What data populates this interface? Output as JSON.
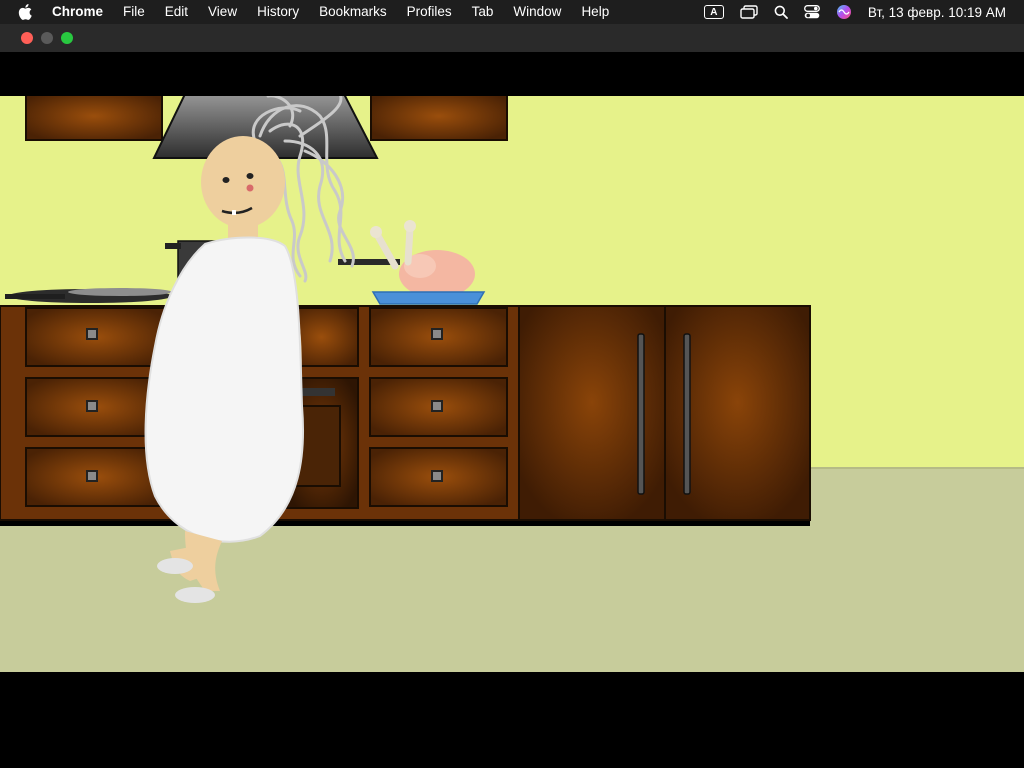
{
  "menubar": {
    "app_name": "Chrome",
    "items": [
      {
        "label": "File"
      },
      {
        "label": "Edit"
      },
      {
        "label": "View"
      },
      {
        "label": "History"
      },
      {
        "label": "Bookmarks"
      },
      {
        "label": "Profiles"
      },
      {
        "label": "Tab"
      },
      {
        "label": "Window"
      },
      {
        "label": "Help"
      }
    ],
    "status": {
      "input_source": "A",
      "clock": "Вт, 13 февр.  10:19 AM"
    }
  },
  "colors": {
    "wall": "#e6f28a",
    "floor": "#c7cc9b",
    "cabinet": "#6b3208",
    "plate": "#4a90d9",
    "dress": "#f5f5f5",
    "skin": "#eecf9e"
  }
}
